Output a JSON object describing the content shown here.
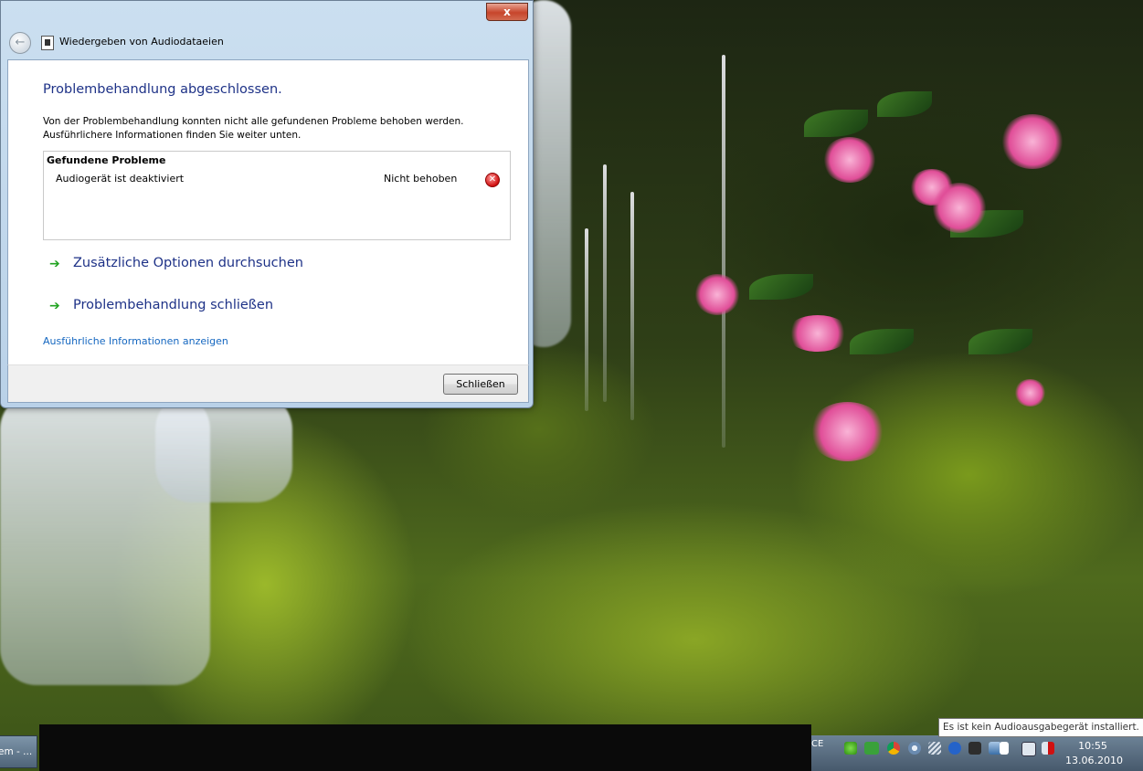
{
  "window": {
    "title": "Wiedergeben von Audiodataeien",
    "close_glyph": "x",
    "back_glyph": "←"
  },
  "content": {
    "heading": "Problembehandlung abgeschlossen.",
    "description_line1": "Von der Problembehandlung konnten nicht alle gefundenen Probleme behoben werden.",
    "description_line2": "Ausführlichere Informationen finden Sie weiter unten.",
    "problems": {
      "header": "Gefundene Probleme",
      "items": [
        {
          "name": "Audiogerät ist deaktiviert",
          "status": "Nicht behoben",
          "icon": "error-icon"
        }
      ]
    },
    "options": [
      {
        "label": "Zusätzliche Optionen durchsuchen",
        "icon": "green-arrow-icon"
      },
      {
        "label": "Problembehandlung schließen",
        "icon": "green-arrow-icon"
      }
    ],
    "details_link": "Ausführliche Informationen anzeigen"
  },
  "footer": {
    "close_button": "Schließen"
  },
  "taskbar": {
    "task_item_label": "em - ...",
    "tray_lang": "CE",
    "tray_icons": [
      "green-star-icon",
      "ovi-icon",
      "chrome-icon",
      "gear-icon",
      "network-icon",
      "bluetooth-icon",
      "device-icon",
      "display-icon",
      "flag-icon",
      "monitor-icon",
      "speaker-muted-icon"
    ],
    "clock_time": "10:55",
    "clock_date": "13.06.2010"
  },
  "tooltip": "Es ist kein Audioausgabegerät installiert.",
  "colors": {
    "heading": "#1e3287",
    "link": "#1567c0",
    "arrow": "#21a321",
    "error": "#d01010"
  }
}
